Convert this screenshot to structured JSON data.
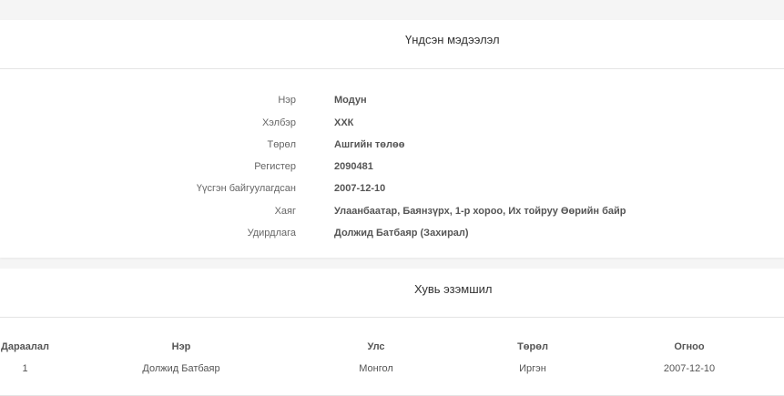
{
  "basic_info": {
    "title": "Үндсэн мэдээлэл",
    "rows": [
      {
        "label": "Нэр",
        "value": "Модун"
      },
      {
        "label": "Хэлбэр",
        "value": "ХХК"
      },
      {
        "label": "Төрөл",
        "value": "Ашгийн төлөө"
      },
      {
        "label": "Регистер",
        "value": "2090481"
      },
      {
        "label": "Үүсгэн байгуулагдсан",
        "value": "2007-12-10"
      },
      {
        "label": "Хаяг",
        "value": "Улаанбаатар, Баянзүрх, 1-р хороо, Их тойруу Өөрийн байр"
      },
      {
        "label": "Удирдлага",
        "value": "Должид Батбаяр (Захирал)"
      }
    ]
  },
  "ownership": {
    "title": "Хувь эзэмшил",
    "columns": [
      "Дараалал",
      "Нэр",
      "Улс",
      "Төрөл",
      "Огноо"
    ],
    "rows": [
      [
        "1",
        "Должид Батбаяр",
        "Монгол",
        "Иргэн",
        "2007-12-10"
      ]
    ]
  }
}
